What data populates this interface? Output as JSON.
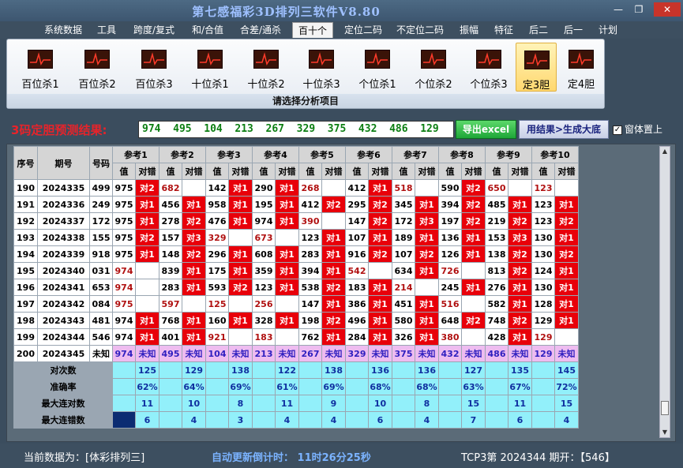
{
  "window": {
    "title": "第七感福彩3D排列三软件V8.80",
    "minimize": "—",
    "maximize": "❐",
    "close": "✕"
  },
  "menu": [
    {
      "label": "系统数据"
    },
    {
      "label": "工具"
    },
    {
      "label": "跨度/复式"
    },
    {
      "label": "和/合值"
    },
    {
      "label": "合差/通杀"
    },
    {
      "label": "百十个"
    },
    {
      "label": "定位二码"
    },
    {
      "label": "不定位二码"
    },
    {
      "label": "振幅"
    },
    {
      "label": "特征"
    },
    {
      "label": "后二"
    },
    {
      "label": "后一"
    },
    {
      "label": "计划"
    }
  ],
  "ribbon": {
    "items": [
      {
        "label": "百位杀1"
      },
      {
        "label": "百位杀2"
      },
      {
        "label": "百位杀3"
      },
      {
        "label": "十位杀1"
      },
      {
        "label": "十位杀2"
      },
      {
        "label": "十位杀3"
      },
      {
        "label": "个位杀1"
      },
      {
        "label": "个位杀2"
      },
      {
        "label": "个位杀3"
      },
      {
        "label": "定3胆"
      },
      {
        "label": "定4胆"
      }
    ],
    "caption": "请选择分析项目"
  },
  "result": {
    "label": "3码定胆预测结果:",
    "value": "974  495  104  213  267  329  375  432  486  129",
    "export_btn": "导出excel",
    "generate_btn": "用结果>生成大底",
    "topmost_label": "窗体置上",
    "topmost_checked": "✓"
  },
  "table": {
    "hdr_seq": "序号",
    "hdr_period": "期号",
    "hdr_code": "号码",
    "refs": [
      "参考1",
      "参考2",
      "参考3",
      "参考4",
      "参考5",
      "参考6",
      "参考7",
      "参考8",
      "参考9",
      "参考10"
    ],
    "sub_val": "值",
    "sub_hit": "对错",
    "rows": [
      {
        "seq": "190",
        "period": "2024335",
        "code": "499",
        "cells": [
          [
            "975",
            "对2"
          ],
          [
            "682",
            ""
          ],
          [
            "142",
            "对1"
          ],
          [
            "290",
            "对1"
          ],
          [
            "268",
            ""
          ],
          [
            "412",
            "对1"
          ],
          [
            "518",
            ""
          ],
          [
            "590",
            "对2"
          ],
          [
            "650",
            ""
          ],
          [
            "123",
            ""
          ]
        ],
        "red": [
          0,
          1,
          0,
          0,
          1,
          0,
          1,
          0,
          1,
          1
        ]
      },
      {
        "seq": "191",
        "period": "2024336",
        "code": "249",
        "cells": [
          [
            "975",
            "对1"
          ],
          [
            "456",
            "对1"
          ],
          [
            "958",
            "对1"
          ],
          [
            "195",
            "对1"
          ],
          [
            "412",
            "对2"
          ],
          [
            "295",
            "对2"
          ],
          [
            "345",
            "对1"
          ],
          [
            "394",
            "对2"
          ],
          [
            "485",
            "对1"
          ],
          [
            "123",
            "对1"
          ]
        ],
        "red": [
          0,
          0,
          0,
          0,
          0,
          0,
          0,
          0,
          0,
          0
        ]
      },
      {
        "seq": "192",
        "period": "2024337",
        "code": "172",
        "cells": [
          [
            "975",
            "对1"
          ],
          [
            "278",
            "对2"
          ],
          [
            "476",
            "对1"
          ],
          [
            "974",
            "对1"
          ],
          [
            "390",
            ""
          ],
          [
            "147",
            "对2"
          ],
          [
            "172",
            "对3"
          ],
          [
            "197",
            "对2"
          ],
          [
            "219",
            "对2"
          ],
          [
            "123",
            "对2"
          ]
        ],
        "red": [
          0,
          0,
          0,
          0,
          1,
          0,
          0,
          0,
          0,
          0
        ]
      },
      {
        "seq": "193",
        "period": "2024338",
        "code": "155",
        "cells": [
          [
            "975",
            "对2"
          ],
          [
            "157",
            "对3"
          ],
          [
            "329",
            ""
          ],
          [
            "673",
            ""
          ],
          [
            "123",
            "对1"
          ],
          [
            "107",
            "对1"
          ],
          [
            "189",
            "对1"
          ],
          [
            "136",
            "对1"
          ],
          [
            "153",
            "对3"
          ],
          [
            "130",
            "对1"
          ]
        ],
        "red": [
          0,
          0,
          1,
          1,
          0,
          0,
          0,
          0,
          0,
          0
        ]
      },
      {
        "seq": "194",
        "period": "2024339",
        "code": "918",
        "cells": [
          [
            "975",
            "对1"
          ],
          [
            "148",
            "对2"
          ],
          [
            "296",
            "对1"
          ],
          [
            "608",
            "对1"
          ],
          [
            "283",
            "对1"
          ],
          [
            "916",
            "对2"
          ],
          [
            "107",
            "对2"
          ],
          [
            "126",
            "对1"
          ],
          [
            "138",
            "对2"
          ],
          [
            "130",
            "对2"
          ]
        ],
        "red": [
          0,
          0,
          0,
          0,
          0,
          0,
          0,
          0,
          0,
          0
        ]
      },
      {
        "seq": "195",
        "period": "2024340",
        "code": "031",
        "cells": [
          [
            "974",
            ""
          ],
          [
            "839",
            "对1"
          ],
          [
            "175",
            "对1"
          ],
          [
            "359",
            "对1"
          ],
          [
            "394",
            "对1"
          ],
          [
            "542",
            ""
          ],
          [
            "634",
            "对1"
          ],
          [
            "726",
            ""
          ],
          [
            "813",
            "对2"
          ],
          [
            "124",
            "对1"
          ]
        ],
        "red": [
          1,
          0,
          0,
          0,
          0,
          1,
          0,
          1,
          0,
          0
        ]
      },
      {
        "seq": "196",
        "period": "2024341",
        "code": "653",
        "cells": [
          [
            "974",
            ""
          ],
          [
            "283",
            "对1"
          ],
          [
            "593",
            "对2"
          ],
          [
            "123",
            "对1"
          ],
          [
            "538",
            "对2"
          ],
          [
            "183",
            "对1"
          ],
          [
            "214",
            ""
          ],
          [
            "245",
            "对1"
          ],
          [
            "276",
            "对1"
          ],
          [
            "130",
            "对1"
          ]
        ],
        "red": [
          1,
          0,
          0,
          0,
          0,
          0,
          1,
          0,
          0,
          0
        ]
      },
      {
        "seq": "197",
        "period": "2024342",
        "code": "084",
        "cells": [
          [
            "975",
            ""
          ],
          [
            "597",
            ""
          ],
          [
            "125",
            ""
          ],
          [
            "256",
            ""
          ],
          [
            "147",
            "对1"
          ],
          [
            "386",
            "对1"
          ],
          [
            "451",
            "对1"
          ],
          [
            "516",
            ""
          ],
          [
            "582",
            "对1"
          ],
          [
            "128",
            "对1"
          ]
        ],
        "red": [
          1,
          1,
          1,
          1,
          0,
          0,
          0,
          1,
          0,
          0
        ]
      },
      {
        "seq": "198",
        "period": "2024343",
        "code": "481",
        "cells": [
          [
            "974",
            "对1"
          ],
          [
            "768",
            "对1"
          ],
          [
            "160",
            "对1"
          ],
          [
            "328",
            "对1"
          ],
          [
            "198",
            "对2"
          ],
          [
            "496",
            "对1"
          ],
          [
            "580",
            "对1"
          ],
          [
            "648",
            "对2"
          ],
          [
            "748",
            "对2"
          ],
          [
            "129",
            "对1"
          ]
        ],
        "red": [
          0,
          0,
          0,
          0,
          0,
          0,
          0,
          0,
          0,
          0
        ]
      },
      {
        "seq": "199",
        "period": "2024344",
        "code": "546",
        "cells": [
          [
            "974",
            "对1"
          ],
          [
            "401",
            "对1"
          ],
          [
            "921",
            ""
          ],
          [
            "183",
            ""
          ],
          [
            "762",
            "对1"
          ],
          [
            "284",
            "对1"
          ],
          [
            "326",
            "对1"
          ],
          [
            "380",
            ""
          ],
          [
            "428",
            "对1"
          ],
          [
            "129",
            ""
          ]
        ],
        "red": [
          0,
          0,
          1,
          1,
          0,
          0,
          0,
          1,
          0,
          1
        ]
      }
    ],
    "pred_row": {
      "seq": "200",
      "period": "2024345",
      "code": "未知",
      "values": [
        "974",
        "495",
        "104",
        "213",
        "267",
        "329",
        "375",
        "432",
        "486",
        "129"
      ],
      "unknown": "未知"
    },
    "stats": [
      {
        "label": "对次数",
        "values": [
          "125",
          "129",
          "138",
          "122",
          "138",
          "136",
          "136",
          "127",
          "135",
          "145"
        ]
      },
      {
        "label": "准确率",
        "values": [
          "62%",
          "64%",
          "69%",
          "61%",
          "69%",
          "68%",
          "68%",
          "63%",
          "67%",
          "72%"
        ]
      },
      {
        "label": "最大连对数",
        "values": [
          "11",
          "10",
          "8",
          "11",
          "9",
          "10",
          "8",
          "15",
          "11",
          "15"
        ]
      },
      {
        "label": "最大连错数",
        "values": [
          "6",
          "4",
          "3",
          "4",
          "4",
          "6",
          "4",
          "7",
          "6",
          "4"
        ]
      }
    ]
  },
  "status": {
    "current_data": "当前数据为：[体彩排列三]",
    "countdown": "自动更新倒计时： 11时26分25秒",
    "draw_info": "TCP3第 2024344 期开：【546】"
  },
  "colors": {
    "hit_red": "#e8000a",
    "pred_pink": "#eebcf0",
    "stat_cyan": "#92f0fa"
  }
}
